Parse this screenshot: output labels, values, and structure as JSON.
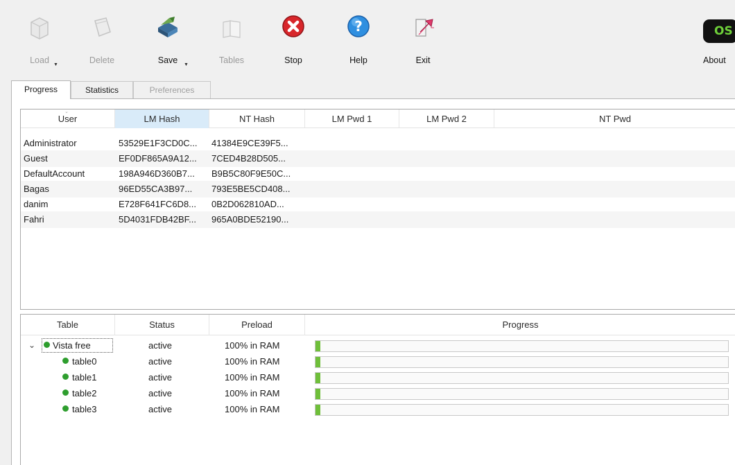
{
  "toolbar": {
    "buttons": [
      {
        "label": "Load",
        "icon": "load-icon",
        "enabled": false,
        "dropdown": true
      },
      {
        "label": "Delete",
        "icon": "delete-icon",
        "enabled": false,
        "dropdown": false
      },
      {
        "label": "Save",
        "icon": "save-icon",
        "enabled": true,
        "dropdown": true
      },
      {
        "label": "Tables",
        "icon": "tables-icon",
        "enabled": false,
        "dropdown": false
      },
      {
        "label": "Stop",
        "icon": "stop-icon",
        "enabled": true,
        "dropdown": false
      },
      {
        "label": "Help",
        "icon": "help-icon",
        "enabled": true,
        "dropdown": false
      },
      {
        "label": "Exit",
        "icon": "exit-icon",
        "enabled": true,
        "dropdown": false
      },
      {
        "label": "About",
        "icon": "about-icon",
        "enabled": true,
        "dropdown": false
      }
    ],
    "about_logo_text": "OS"
  },
  "tabs": [
    {
      "label": "Progress",
      "active": true,
      "enabled": true
    },
    {
      "label": "Statistics",
      "active": false,
      "enabled": true
    },
    {
      "label": "Preferences",
      "active": false,
      "enabled": false
    }
  ],
  "users_table": {
    "columns": [
      "User",
      "LM Hash",
      "NT Hash",
      "LM Pwd 1",
      "LM Pwd 2",
      "NT Pwd"
    ],
    "sorted_column": "LM Hash",
    "rows": [
      {
        "user": "Administrator",
        "lm_hash": "53529E1F3CD0C...",
        "nt_hash": "41384E9CE39F5...",
        "lm_pwd1": "",
        "lm_pwd2": "",
        "nt_pwd": ""
      },
      {
        "user": "Guest",
        "lm_hash": "EF0DF865A9A12...",
        "nt_hash": "7CED4B28D505...",
        "lm_pwd1": "",
        "lm_pwd2": "",
        "nt_pwd": ""
      },
      {
        "user": "DefaultAccount",
        "lm_hash": "198A946D360B7...",
        "nt_hash": "B9B5C80F9E50C...",
        "lm_pwd1": "",
        "lm_pwd2": "",
        "nt_pwd": ""
      },
      {
        "user": "Bagas",
        "lm_hash": "96ED55CA3B97...",
        "nt_hash": "793E5BE5CD408...",
        "lm_pwd1": "",
        "lm_pwd2": "",
        "nt_pwd": ""
      },
      {
        "user": "danim",
        "lm_hash": "E728F641FC6D8...",
        "nt_hash": "0B2D062810AD...",
        "lm_pwd1": "",
        "lm_pwd2": "",
        "nt_pwd": ""
      },
      {
        "user": "Fahri",
        "lm_hash": "5D4031FDB42BF...",
        "nt_hash": "965A0BDE52190...",
        "lm_pwd1": "",
        "lm_pwd2": "",
        "nt_pwd": ""
      }
    ]
  },
  "tables_tree": {
    "columns": [
      "Table",
      "Status",
      "Preload",
      "Progress"
    ],
    "rows": [
      {
        "name": "Vista free",
        "status": "active",
        "preload": "100% in RAM",
        "progress": 0.01,
        "level": 0,
        "expanded": true
      },
      {
        "name": "table0",
        "status": "active",
        "preload": "100% in RAM",
        "progress": 0.01,
        "level": 1
      },
      {
        "name": "table1",
        "status": "active",
        "preload": "100% in RAM",
        "progress": 0.01,
        "level": 1
      },
      {
        "name": "table2",
        "status": "active",
        "preload": "100% in RAM",
        "progress": 0.01,
        "level": 1
      },
      {
        "name": "table3",
        "status": "active",
        "preload": "100% in RAM",
        "progress": 0.01,
        "level": 1
      }
    ]
  },
  "colors": {
    "status_dot": "#2e9e2e",
    "progress_fill": "#6fbf3a",
    "sorted_header": "#d9ebf9",
    "stop_red": "#d8262b",
    "help_blue": "#2f8fe0",
    "exit_pink": "#e0386a"
  }
}
